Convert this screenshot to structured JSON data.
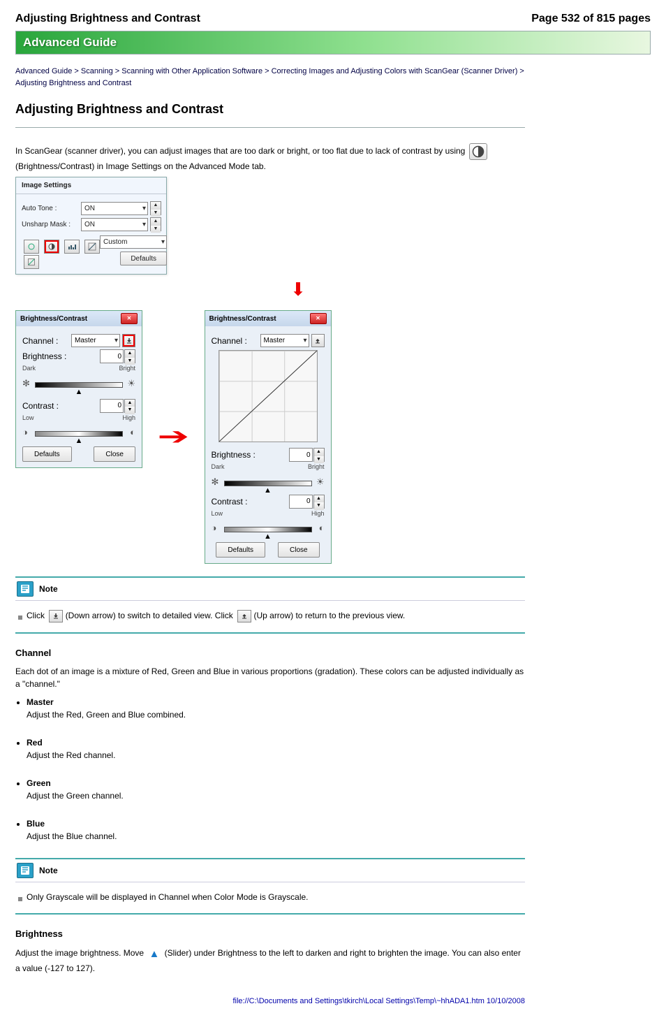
{
  "header": {
    "title": "Adjusting Brightness and Contrast",
    "page_info": "Page 532 of 815 pages"
  },
  "banner": "Advanced Guide",
  "breadcrumb": "Advanced Guide > Scanning > Scanning with Other Application Software > Correcting Images and Adjusting Colors with ScanGear (Scanner Driver) > Adjusting Brightness and Contrast",
  "page_title": "Adjusting Brightness and Contrast",
  "intro": "In ScanGear (scanner driver), you can adjust images that are too dark or bright, or too flat due to lack of contrast by using",
  "intro2": "(Brightness/Contrast) in Image Settings on the Advanced Mode tab.",
  "imgset": {
    "title": "Image Settings",
    "auto_tone_label": "Auto Tone :",
    "auto_tone_value": "ON",
    "unsharp_label": "Unsharp Mask :",
    "unsharp_value": "ON",
    "custom": "Custom",
    "defaults": "Defaults"
  },
  "dlg": {
    "title": "Brightness/Contrast",
    "channel_label": "Channel :",
    "channel_value": "Master",
    "brightness_label": "Brightness :",
    "brightness_value": "0",
    "dark": "Dark",
    "bright": "Bright",
    "contrast_label": "Contrast :",
    "contrast_value": "0",
    "low": "Low",
    "high": "High",
    "defaults": "Defaults",
    "close": "Close"
  },
  "note1": {
    "heading": "Note",
    "l1a": "Click",
    "l1b": "(Down arrow) to switch to detailed view. Click",
    "l1c": "(Up arrow) to return to the previous view."
  },
  "channel_section": {
    "title": "Channel",
    "p1": "Each dot of an image is a mixture of Red, Green and Blue in various proportions (gradation). These colors can be adjusted individually as a \"channel.\"",
    "items": [
      {
        "label": "Master",
        "desc": "Adjust the Red, Green and Blue combined."
      },
      {
        "label": "Red",
        "desc": "Adjust the Red channel."
      },
      {
        "label": "Green",
        "desc": "Adjust the Green channel."
      },
      {
        "label": "Blue",
        "desc": "Adjust the Blue channel."
      }
    ]
  },
  "note2": {
    "heading": "Note",
    "line": "Only Grayscale will be displayed in Channel when Color Mode is Grayscale."
  },
  "brightness_section": {
    "title": "Brightness",
    "p1a": "Adjust the image brightness. Move",
    "p1b": "(Slider) under Brightness to the left to darken and right to brighten the image. You can also enter a value (-127 to 127)."
  },
  "footer": "file://C:\\Documents and Settings\\tkirch\\Local Settings\\Temp\\~hhADA1.htm   10/10/2008"
}
